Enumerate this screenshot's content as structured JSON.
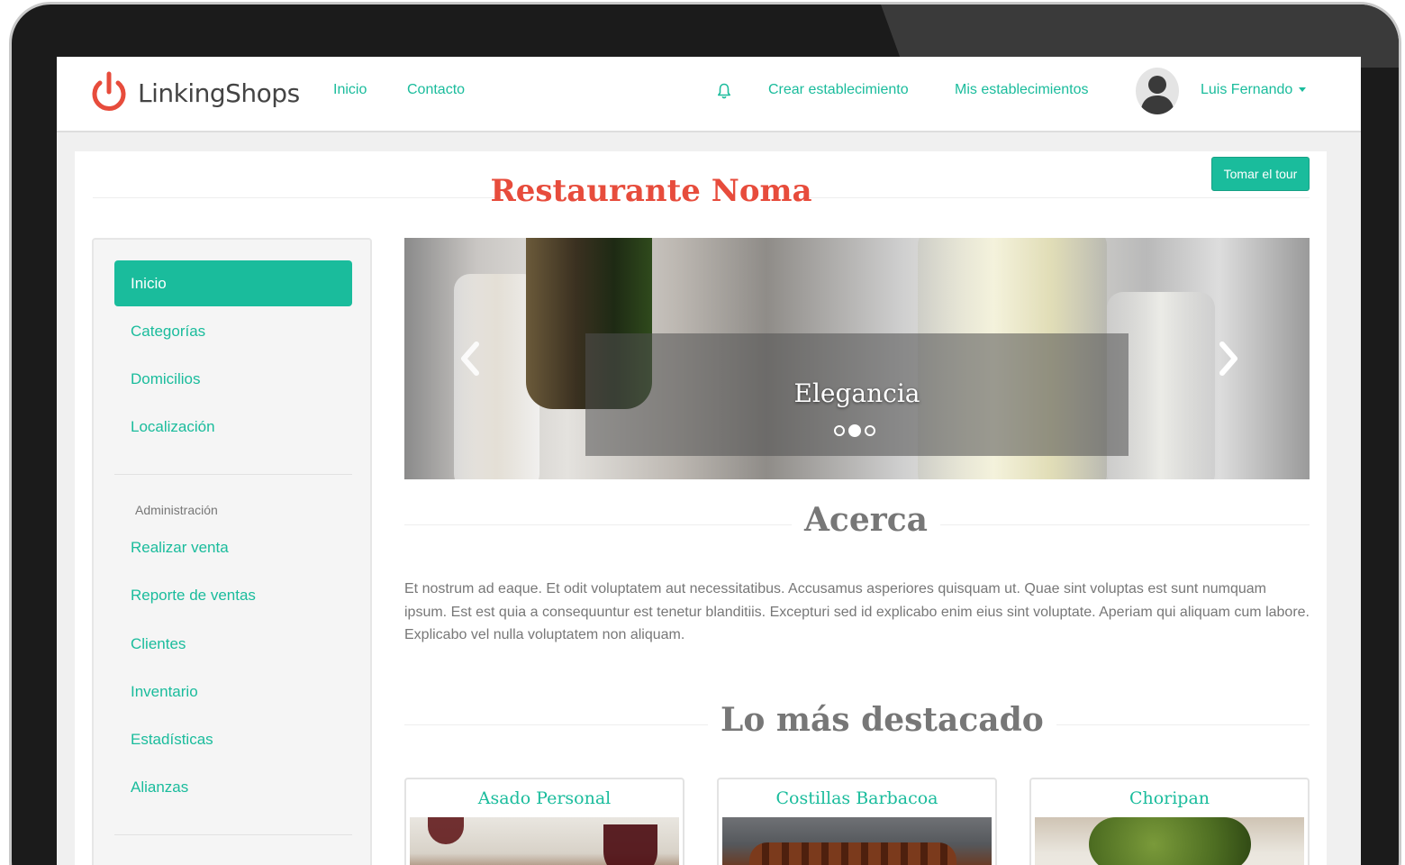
{
  "app": {
    "brand": "LinkingShops"
  },
  "nav": {
    "left": [
      "Inicio",
      "Contacto"
    ],
    "create": "Crear establecimiento",
    "mine": "Mis establecimientos",
    "user": "Luis Fernando"
  },
  "page": {
    "title": "Restaurante Noma",
    "tour_button": "Tomar el tour"
  },
  "sidebar": {
    "items": [
      "Inicio",
      "Categorías",
      "Domicilios",
      "Localización"
    ],
    "admin_header": "Administración",
    "admin_items": [
      "Realizar venta",
      "Reporte de ventas",
      "Clientes",
      "Inventario",
      "Estadísticas",
      "Alianzas"
    ]
  },
  "carousel": {
    "caption": "Elegancia",
    "slides": 3,
    "active_slide": 2
  },
  "about": {
    "title": "Acerca",
    "text": "Et nostrum ad eaque. Et odit voluptatem aut necessitatibus. Accusamus asperiores quisquam ut. Quae sint voluptas est sunt numquam ipsum. Est est quia a consequuntur est tenetur blanditiis. Excepturi sed id explicabo enim eius sint voluptate. Aperiam qui aliquam cum labore. Explicabo vel nulla voluptatem non aliquam."
  },
  "featured": {
    "title": "Lo más destacado",
    "items": [
      "Asado Personal",
      "Costillas Barbacoa",
      "Choripan"
    ]
  },
  "colors": {
    "accent": "#1abc9c",
    "title_red": "#e74c3c",
    "text_gray": "#777777"
  }
}
